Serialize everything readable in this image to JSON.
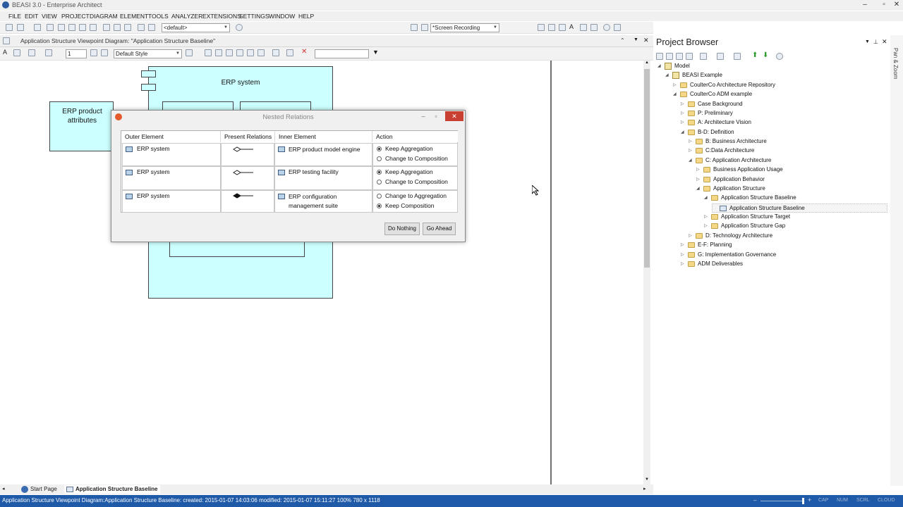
{
  "window": {
    "title": "BEASI 3.0 - Enterprise Architect",
    "controls": [
      "–",
      "▫",
      "✕"
    ]
  },
  "menu": [
    "FILE",
    "EDIT",
    "VIEW",
    "PROJECT",
    "DIAGRAM",
    "ELEMENT",
    "TOOLS",
    "ANALYZER",
    "EXTENSIONS",
    "SETTINGS",
    "WINDOW",
    "HELP"
  ],
  "toolbar": {
    "perspective_combo": "<default>",
    "recording_combo": "*Screen Recording",
    "zoom_value": "1",
    "style_combo": "Default Style"
  },
  "diagram": {
    "header_title": "Application Structure Viewpoint Diagram: \"Application Structure Baseline\"",
    "elements": {
      "erp_system": "ERP system",
      "erp_product_attributes": "ERP product attributes"
    }
  },
  "dialog": {
    "title": "Nested Relations",
    "columns": [
      "Outer Element",
      "Present Relations",
      "Inner Element",
      "Action"
    ],
    "rows": [
      {
        "outer": "ERP system",
        "inner": "ERP product model engine",
        "options": [
          "Keep Aggregation",
          "Change to Composition"
        ],
        "selected": 0,
        "relation": "aggregation"
      },
      {
        "outer": "ERP system",
        "inner": "ERP testing facility",
        "options": [
          "Keep Aggregation",
          "Change to Composition"
        ],
        "selected": 0,
        "relation": "aggregation"
      },
      {
        "outer": "ERP system",
        "inner": "ERP configuration management suite",
        "options": [
          "Change to Aggregation",
          "Keep Composition"
        ],
        "selected": 1,
        "relation": "composition"
      }
    ],
    "do_nothing_label": "Do Nothing",
    "go_ahead_label": "Go Ahead"
  },
  "project_browser": {
    "title": "Project Browser",
    "side_label": "Pan & Zoom",
    "tree": [
      {
        "label": "Model",
        "level": 0,
        "type": "model",
        "expanded": true
      },
      {
        "label": "BEASI Example",
        "level": 1,
        "type": "package",
        "expanded": true
      },
      {
        "label": "CoulterCo Architecture Repository",
        "level": 2,
        "type": "folder",
        "expanded": false
      },
      {
        "label": "CoulterCo ADM example",
        "level": 2,
        "type": "folder",
        "expanded": true
      },
      {
        "label": "Case Background",
        "level": 3,
        "type": "folder",
        "expanded": false
      },
      {
        "label": "P: Preliminary",
        "level": 3,
        "type": "folder",
        "expanded": false
      },
      {
        "label": "A: Architecture Vision",
        "level": 3,
        "type": "folder",
        "expanded": false
      },
      {
        "label": "B-D: Definition",
        "level": 3,
        "type": "folder",
        "expanded": true
      },
      {
        "label": "B: Business Architecture",
        "level": 4,
        "type": "folder",
        "expanded": false
      },
      {
        "label": "C:Data Architecture",
        "level": 4,
        "type": "folder",
        "expanded": false
      },
      {
        "label": "C: Application Architecture",
        "level": 4,
        "type": "folder",
        "expanded": true
      },
      {
        "label": "Business Application Usage",
        "level": 5,
        "type": "folder",
        "expanded": false
      },
      {
        "label": "Application Behavior",
        "level": 5,
        "type": "folder",
        "expanded": false
      },
      {
        "label": "Application Structure",
        "level": 5,
        "type": "folder",
        "expanded": true
      },
      {
        "label": "Application Structure Baseline",
        "level": 6,
        "type": "folder",
        "expanded": true
      },
      {
        "label": "Application Structure Baseline",
        "level": 7,
        "type": "diagram",
        "expanded": null,
        "selected": true
      },
      {
        "label": "Application Structure Target",
        "level": 6,
        "type": "folder",
        "expanded": false
      },
      {
        "label": "Application Structure Gap",
        "level": 6,
        "type": "folder",
        "expanded": false
      },
      {
        "label": "D: Technology Architecture",
        "level": 4,
        "type": "folder",
        "expanded": false
      },
      {
        "label": "E-F: Planning",
        "level": 3,
        "type": "folder",
        "expanded": false
      },
      {
        "label": "G: Implementation Governance",
        "level": 3,
        "type": "folder",
        "expanded": false
      },
      {
        "label": "ADM Deliverables",
        "level": 3,
        "type": "folder",
        "expanded": false
      }
    ]
  },
  "bottom_tabs": [
    "Start Page",
    "Application Structure Baseline"
  ],
  "status": {
    "text": "Application Structure Viewpoint Diagram:Application Structure Baseline:  created: 2015-01-07 14:03:06  modified: 2015-01-07 15:11:27  100%   780 x 1118",
    "indicators": [
      "CAP",
      "NUM",
      "SCRL",
      "CLOUD"
    ]
  },
  "colors": {
    "element_fill": "#ccffff",
    "status_bar": "#1f5aa8",
    "close_button": "#c84032"
  }
}
